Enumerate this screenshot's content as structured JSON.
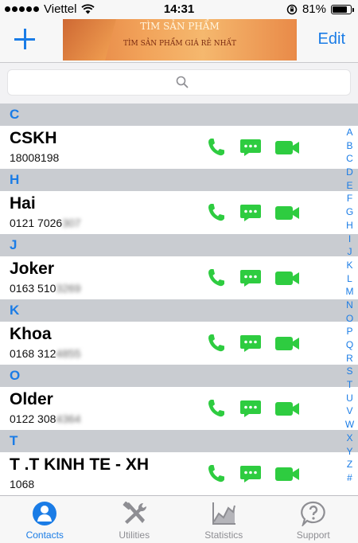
{
  "status_bar": {
    "carrier": "Viettel",
    "time": "14:31",
    "battery": "81%",
    "battery_level": 0.81
  },
  "nav": {
    "edit_label": "Edit",
    "ad_title": "TÌM SẢN PHẨM",
    "ad_subtitle": "TÌM SẢN PHẨM GIÁ RẺ NHẤT"
  },
  "search": {
    "placeholder": ""
  },
  "sections": [
    {
      "letter": "C",
      "contact": {
        "name": "CSKH",
        "number_visible": "18008198",
        "number_hidden": ""
      }
    },
    {
      "letter": "H",
      "contact": {
        "name": "Hai",
        "number_visible": "0121 7026",
        "number_hidden": "307"
      }
    },
    {
      "letter": "J",
      "contact": {
        "name": "Joker",
        "number_visible": "0163 510",
        "number_hidden": "3269"
      }
    },
    {
      "letter": "K",
      "contact": {
        "name": "Khoa",
        "number_visible": "0168 312",
        "number_hidden": "4855"
      }
    },
    {
      "letter": "O",
      "contact": {
        "name": "Older",
        "number_visible": "0122 308",
        "number_hidden": "4364"
      }
    },
    {
      "letter": "T",
      "contact": {
        "name": "T .T KINH TE - XH",
        "number_visible": "1068",
        "number_hidden": ""
      }
    }
  ],
  "index": [
    "A",
    "B",
    "C",
    "D",
    "E",
    "F",
    "G",
    "H",
    "I",
    "J",
    "K",
    "L",
    "M",
    "N",
    "O",
    "P",
    "Q",
    "R",
    "S",
    "T",
    "U",
    "V",
    "W",
    "X",
    "Y",
    "Z",
    "#"
  ],
  "tabs": [
    {
      "label": "Contacts",
      "icon": "contacts-icon",
      "active": true
    },
    {
      "label": "Utilities",
      "icon": "tools-icon",
      "active": false
    },
    {
      "label": "Statistics",
      "icon": "chart-icon",
      "active": false
    },
    {
      "label": "Support",
      "icon": "help-icon",
      "active": false
    }
  ],
  "colors": {
    "accent": "#1a7ce6",
    "action_green": "#2ecc40",
    "section_bg": "#c9ccd1",
    "tab_inactive": "#8e8e93"
  }
}
